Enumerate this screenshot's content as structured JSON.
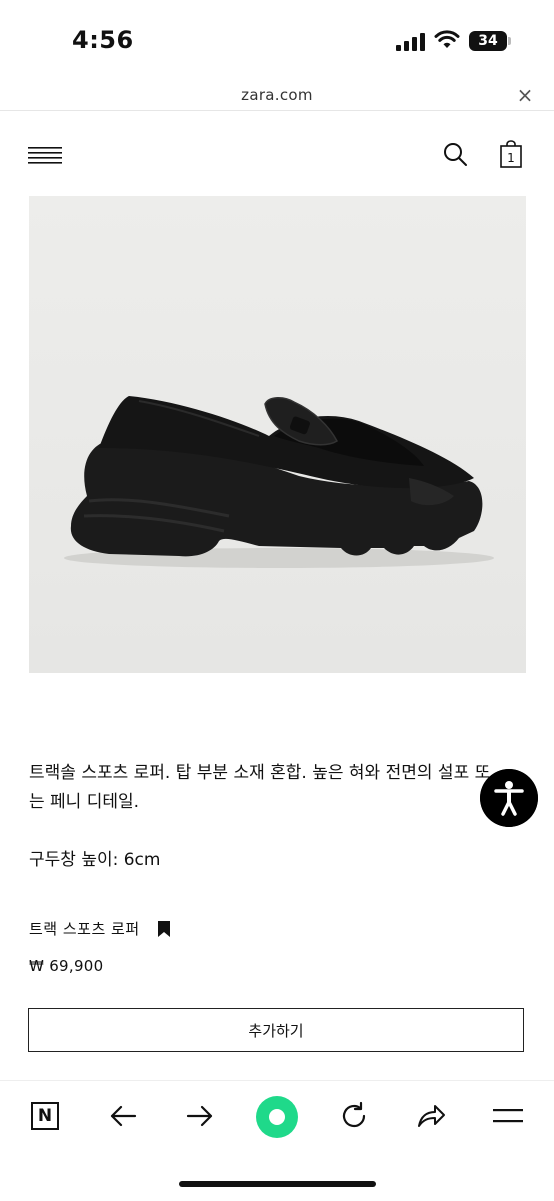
{
  "status_bar": {
    "time": "4:56",
    "battery": "34"
  },
  "url_bar": {
    "domain": "zara.com",
    "close": "×"
  },
  "product": {
    "description_line1": "트랙솔 스포츠 로퍼. 탑 부분 소재 혼합. 높은 혀와 전면의 설포 또",
    "description_line2": "는 페니 디테일.",
    "sole_height": "구두창 높이: 6cm",
    "name": "트랙 스포츠 로퍼",
    "price": "₩ 69,900",
    "add_button": "추가하기"
  },
  "toolbar": {
    "n_tab": "N"
  },
  "colors": {
    "accent": "#1fd98a",
    "image_bg": "#ececea"
  }
}
